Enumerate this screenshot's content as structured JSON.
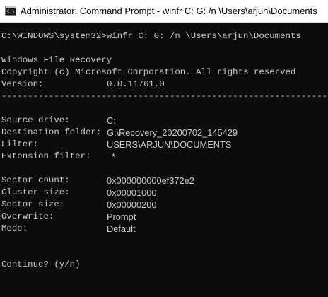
{
  "window": {
    "title": "Administrator: Command Prompt - winfr  C: G: /n \\Users\\arjun\\Documents",
    "icon": "command-prompt-icon",
    "icon_text": "C:\\."
  },
  "console": {
    "command": {
      "prompt": "C:\\WINDOWS\\system32>",
      "input": "winfr C: G: /n \\Users\\arjun\\Documents"
    },
    "header": {
      "app_name": "Windows File Recovery",
      "copyright": "Copyright (c) Microsoft Corporation. All rights reserved",
      "version_label": "Version:",
      "version_value": "0.0.11761.0"
    },
    "separator": "---------------------------------------------------------------",
    "settings": [
      {
        "label": "Source drive:",
        "value": "C:"
      },
      {
        "label": "Destination folder:",
        "value": "G:\\Recovery_20200702_145429"
      },
      {
        "label": "Filter:",
        "value": "USERS\\ARJUN\\DOCUMENTS"
      },
      {
        "label": "Extension filter:",
        "value": "  *"
      }
    ],
    "stats": [
      {
        "label": "Sector count:",
        "value": "0x000000000ef372e2"
      },
      {
        "label": "Cluster size:",
        "value": "0x00001000"
      },
      {
        "label": "Sector size:",
        "value": "0x00000200"
      },
      {
        "label": "Overwrite:",
        "value": "Prompt"
      },
      {
        "label": "Mode:",
        "value": "Default"
      }
    ],
    "continue_prompt": "Continue? (y/n)"
  },
  "colors": {
    "background": "#0c0c0c",
    "text": "#cccccc",
    "titlebar": "#ffffff"
  }
}
